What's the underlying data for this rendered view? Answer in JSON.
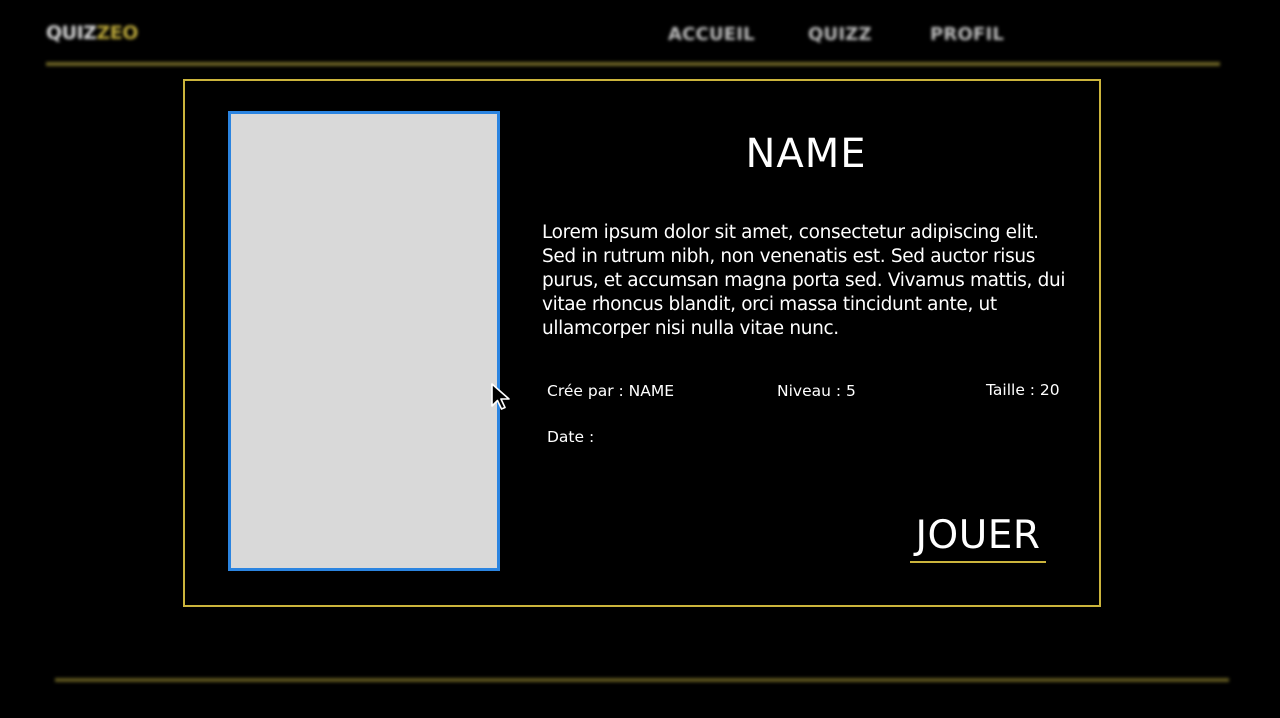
{
  "header": {
    "logo_main": "QUIZ",
    "logo_accent": "ZEO",
    "nav": [
      {
        "label": "ACCUEIL"
      },
      {
        "label": "QUIZZ"
      },
      {
        "label": "PROFIL"
      }
    ]
  },
  "quiz": {
    "name": "NAME",
    "description": "Lorem ipsum dolor sit amet, consectetur adipiscing elit. Sed in rutrum nibh, non venenatis est. Sed auctor risus purus, et accumsan magna porta sed. Vivamus mattis, dui vitae rhoncus blandit, orci massa tincidunt ante, ut ullamcorper nisi nulla vitae nunc.",
    "author_label": "Crée par : NAME",
    "level_label": "Niveau : 5",
    "size_label": "Taille : 20",
    "date_label": "Date :",
    "play_label": "JOUER"
  },
  "colors": {
    "background": "#000000",
    "accent_gold": "#cbb43c",
    "thumbnail_border": "#2b84e0",
    "thumbnail_fill": "#d9d9d9"
  },
  "icons": {
    "cursor": "mouse-pointer-icon"
  }
}
